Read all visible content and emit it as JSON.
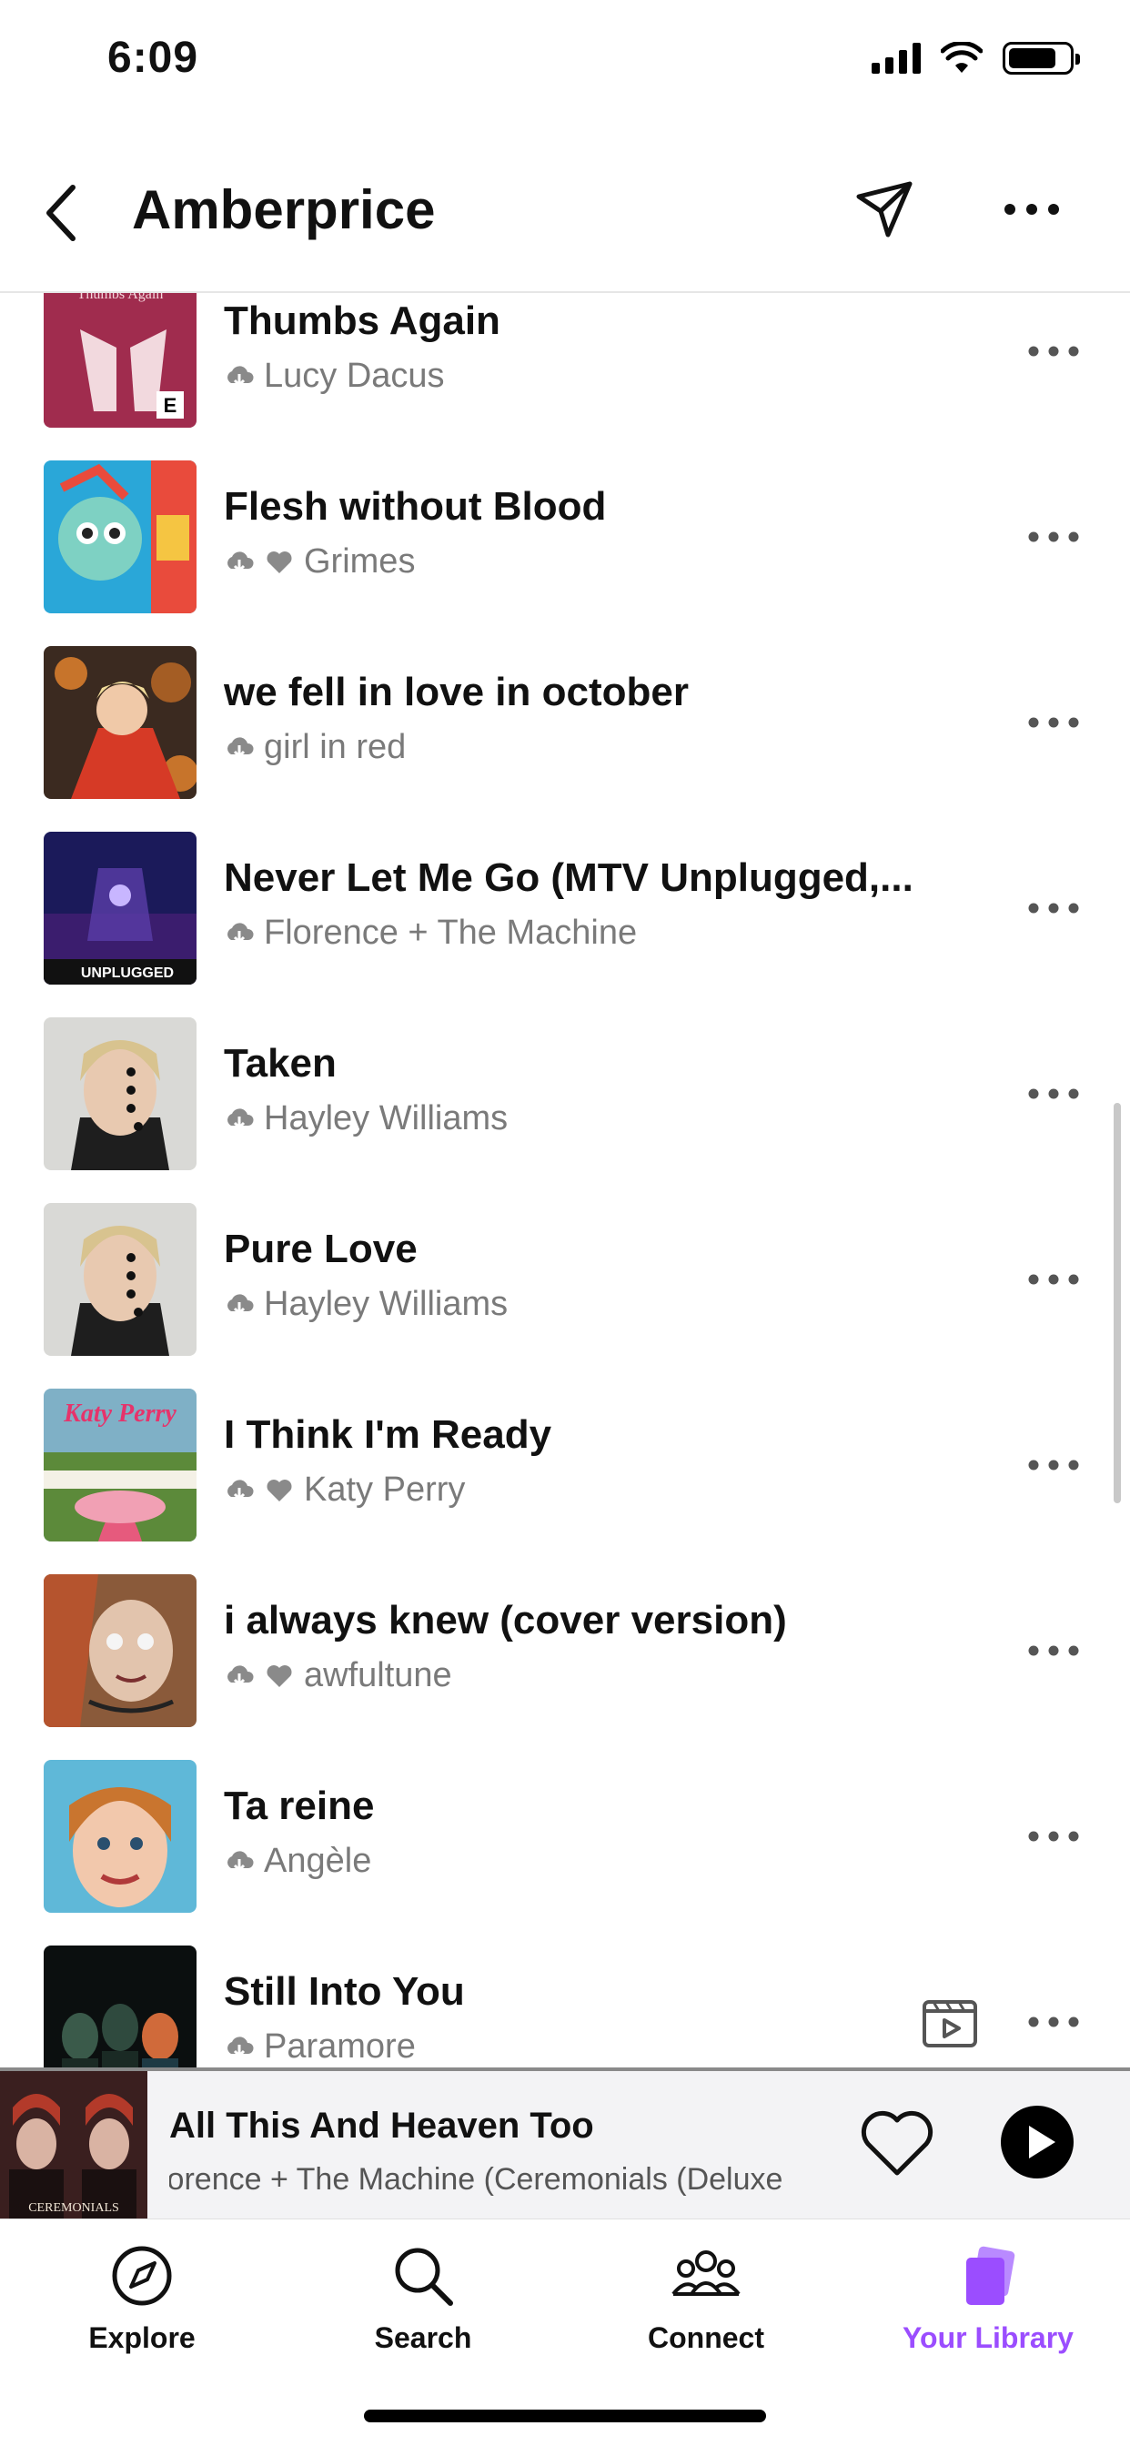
{
  "status_bar": {
    "time": "6:09"
  },
  "header": {
    "title": "Amberprice"
  },
  "tracks": [
    {
      "title": "Thumbs Again",
      "artist": "Lucy Dacus",
      "liked": false,
      "explicit": true,
      "art_text": "Thumbs Again"
    },
    {
      "title": "Flesh without Blood",
      "artist": "Grimes",
      "liked": true,
      "explicit": false
    },
    {
      "title": "we fell in love in october",
      "artist": "girl in red",
      "liked": false,
      "explicit": false
    },
    {
      "title": "Never Let Me Go (MTV Unplugged,...",
      "artist": "Florence + The Machine",
      "liked": false,
      "explicit": false,
      "art_text": "UNPLUGGED"
    },
    {
      "title": "Taken",
      "artist": "Hayley Williams",
      "liked": false,
      "explicit": false
    },
    {
      "title": "Pure Love",
      "artist": "Hayley Williams",
      "liked": false,
      "explicit": false
    },
    {
      "title": "I Think I'm Ready",
      "artist": "Katy Perry",
      "liked": true,
      "explicit": false,
      "art_text": "Katy Perry"
    },
    {
      "title": "i always knew (cover version)",
      "artist": "awfultune",
      "liked": true,
      "explicit": false
    },
    {
      "title": "Ta reine",
      "artist": "Angèle",
      "liked": false,
      "explicit": false
    },
    {
      "title": "Still Into You",
      "artist": "Paramore",
      "liked": false,
      "explicit": false,
      "has_video": true
    }
  ],
  "now_playing": {
    "title": "All This And Heaven Too",
    "subtitle": "lorence + The Machine  (Ceremonials (Deluxe",
    "art_text": "CEREMONIALS"
  },
  "tabs": [
    {
      "label": "Explore",
      "icon": "compass-icon"
    },
    {
      "label": "Search",
      "icon": "search-icon"
    },
    {
      "label": "Connect",
      "icon": "people-icon"
    },
    {
      "label": "Your Library",
      "icon": "library-icon",
      "active": true
    }
  ],
  "colors": {
    "accent": "#9b4dff",
    "secondary_text": "#7a7a7a",
    "mini_player_bg": "#f3f3f5"
  }
}
